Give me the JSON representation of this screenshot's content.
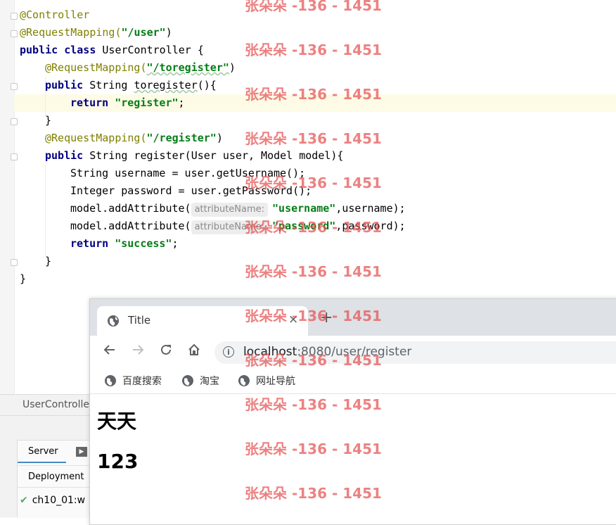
{
  "editor": {
    "lines": {
      "l1_ann": "@Controller",
      "l2_ann": "@RequestMapping(",
      "l2_str": "\"/user\"",
      "l2_end": ")",
      "l3_kw": "public class",
      "l3_rest": " UserController {",
      "l4_ann": "@RequestMapping(",
      "l4_str": "\"/toregister\"",
      "l4_end": ")",
      "l5_kw": "public",
      "l5_rest": " String ",
      "l5_method": "toregister",
      "l5_end": "(){",
      "l6_kw": "return",
      "l6_str": "\"register\"",
      "l6_end": ";",
      "l7": "}",
      "l8_ann": "@RequestMapping(",
      "l8_str": "\"/register\"",
      "l8_end": ")",
      "l9_kw": "public",
      "l9_rest": " String register(User user, Model model){",
      "l10": "String username = user.getUsername();",
      "l11": "Integer password = user.getPassword();",
      "l12_pre": "model.addAttribute(",
      "l12_hint": "attributeName:",
      "l12_str": "\"username\"",
      "l12_end": ",username);",
      "l13_pre": "model.addAttribute(",
      "l13_hint": "attributeName:",
      "l13_str": "\"password\"",
      "l13_end": ",password);",
      "l14_kw": "return",
      "l14_str": "\"success\"",
      "l14_end": ";",
      "l15": "}",
      "l16": "}"
    }
  },
  "ide": {
    "file_tab": "UserControlle",
    "server_tab": "Server",
    "deployment_tab": "Deployment",
    "artifact": "ch10_01:w"
  },
  "browser": {
    "tab_title": "Title",
    "close_glyph": "×",
    "newtab_glyph": "+",
    "url_host": "localhost",
    "url_path": ":8080/user/register",
    "bookmarks": [
      "百度搜索",
      "淘宝",
      "网址导航"
    ],
    "heading_username": "天天",
    "heading_password": "123",
    "icons": [
      "globe-icon",
      "back-icon",
      "forward-icon",
      "reload-icon",
      "home-icon",
      "info-icon"
    ]
  },
  "watermark": "张朵朵 -136 - 1451",
  "colors": {
    "annotation": "#808000",
    "keyword": "#000080",
    "string": "#067d17",
    "watermark": "#e65050"
  }
}
